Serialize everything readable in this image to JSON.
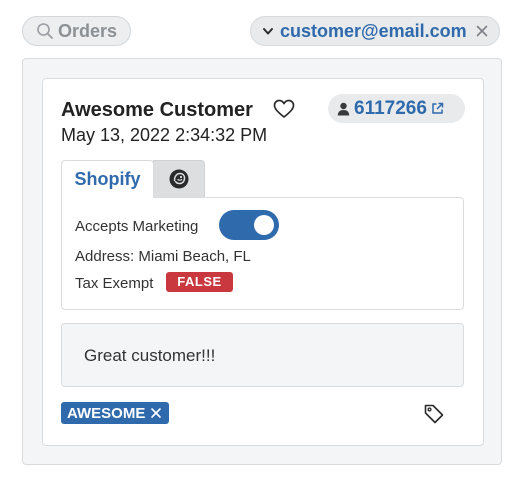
{
  "filters": {
    "orders_label": "Orders",
    "email_label": "customer@email.com"
  },
  "customer": {
    "name": "Awesome Customer",
    "date": "May 13, 2022 2:34:32 PM",
    "id": "6117266"
  },
  "tabs": [
    {
      "label": "Shopify",
      "active": true
    },
    {
      "icon": "mailchimp-icon",
      "active": false
    }
  ],
  "shopify": {
    "accepts_marketing_label": "Accepts Marketing",
    "accepts_marketing": true,
    "address": "Address: Miami Beach, FL",
    "tax_exempt_label": "Tax Exempt",
    "tax_exempt_value": "FALSE"
  },
  "note": "Great customer!!!",
  "tags": [
    {
      "label": "AWESOME"
    }
  ],
  "colors": {
    "accent": "#2f6aad",
    "danger": "#c9383f",
    "muted": "#8c9196"
  }
}
